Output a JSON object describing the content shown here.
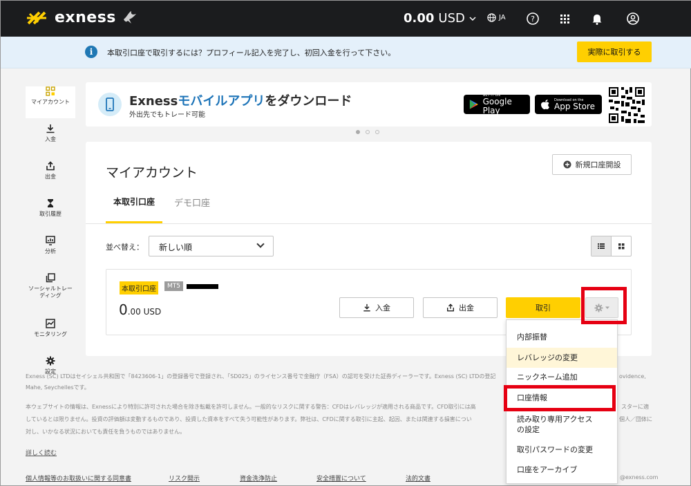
{
  "header": {
    "logo": "exness",
    "balance_amount": "0.00",
    "balance_currency": "USD",
    "language": "JA"
  },
  "info_banner": {
    "icon": "info-icon",
    "text": "本取引口座で取引するには？プロフィール記入を完了し、初回入金を行って下さい。",
    "button": "実際に取引する"
  },
  "sidebar": {
    "items": [
      {
        "label": "マイアカウント",
        "icon": "grid-icon"
      },
      {
        "label": "入金",
        "icon": "download-icon"
      },
      {
        "label": "出金",
        "icon": "upload-icon"
      },
      {
        "label": "取引履歴",
        "icon": "hourglass-icon"
      },
      {
        "label": "分析",
        "icon": "analytics-icon"
      },
      {
        "label": "ソーシャルトレーディング",
        "icon": "copy-icon"
      },
      {
        "label": "モニタリング",
        "icon": "monitoring-icon"
      },
      {
        "label": "設定",
        "icon": "gear-icon"
      }
    ]
  },
  "promo": {
    "title_prefix": "Exness",
    "title_highlight": "モバイルアプリ",
    "title_suffix": "をダウンロード",
    "subtitle": "外出先でもトレード可能",
    "google_small": "GET IT ON",
    "google_big": "Google Play",
    "apple_small": "Download on the",
    "apple_big": "App Store"
  },
  "account": {
    "title": "マイアカウント",
    "new_account_button": "新規口座開設",
    "tabs": [
      "本取引口座",
      "デモ口座"
    ],
    "sort_label": "並べ替え：",
    "sort_value": "新しい順",
    "row": {
      "type_badge": "本取引口座",
      "platform_badge": "MT5",
      "balance_int": "0",
      "balance_rest": ".00 USD",
      "deposit_button": "入金",
      "withdraw_button": "出金",
      "trade_button": "取引"
    }
  },
  "menu": {
    "items": [
      "内部振替",
      "レバレッジの変更",
      "ニックネーム追加",
      "口座情報",
      "読み取り専用アクセスの設定",
      "取引パスワードの変更",
      "口座をアーカイブ"
    ]
  },
  "footer": {
    "line1": "Exness (SC) LTDはセイシェル共和国で「8423606-1」の登録番号で登録され、「SD025」のライセンス番号で金融庁（FSA）の認可を受けた証券ディーラーです。Exness (SC) LTDの登記上",
    "line1_end": "ovidence,",
    "line2": "Mahe, Seychellesです。",
    "line3": "本ウェブサイトの情報は、Exnessにより特別に許可された場合を除き転載を許可しません。一般的なリスクに関する警告：CFDはレバレッジが適用される商品です。CFD取引には高",
    "line3_end": "スターに適",
    "line4": "しているとは限りません。投資の評価額は変動するものであり、投資した資本をすべて失う可能性があります。弊社は、CFDに関する取引に主起、起因、または関連する損害につい",
    "line4_end": "個人／団体に",
    "line5": "対し、いかなる状況においても責任を負うものではありません。",
    "read_more": "詳しく読む",
    "links": [
      "個人情報等のお取扱いに関する同意書",
      "リスク開示",
      "資金洗浄防止",
      "安全措置について",
      "法的文書"
    ],
    "email_fragment": "@exness.com"
  },
  "colors": {
    "accent": "#ffcf01",
    "topbar": "#1b1c1e",
    "highlight": "#e60012",
    "link_blue": "#1d74b8"
  }
}
